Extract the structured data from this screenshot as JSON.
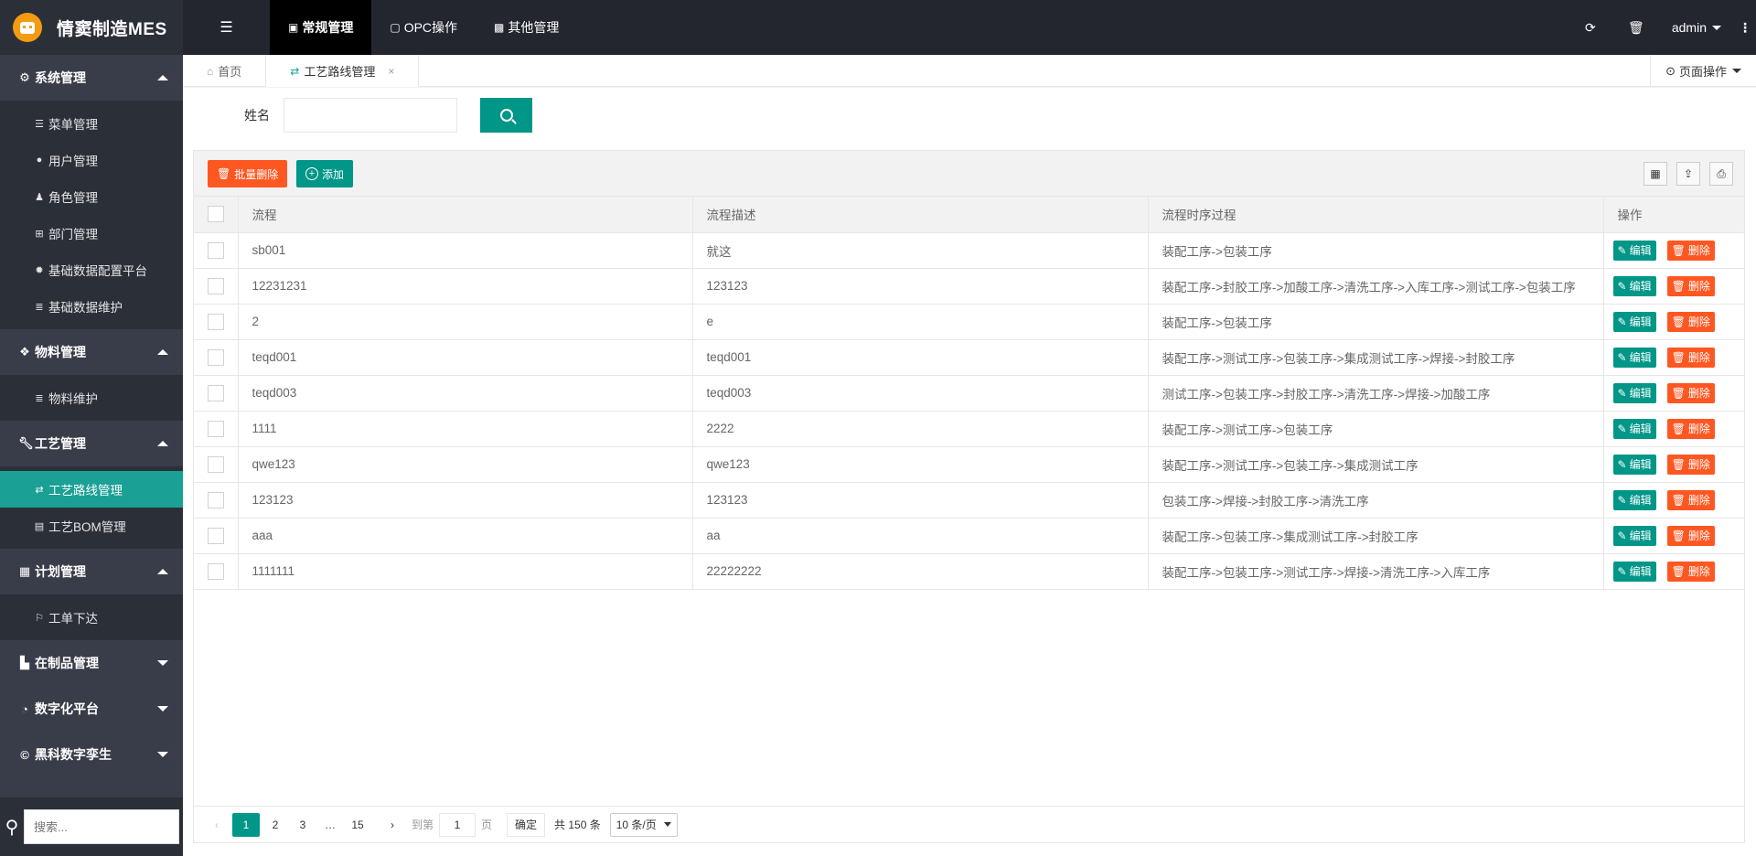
{
  "app": {
    "title": "情窦制造MES"
  },
  "sidebar": {
    "groups": [
      {
        "label": "系统管理",
        "icon": "gears-icon",
        "expanded": true,
        "items": [
          {
            "label": "菜单管理",
            "icon": "list-icon"
          },
          {
            "label": "用户管理",
            "icon": "user-icon"
          },
          {
            "label": "角色管理",
            "icon": "role-icon"
          },
          {
            "label": "部门管理",
            "icon": "sitemap-icon"
          },
          {
            "label": "基础数据配置平台",
            "icon": "gear-icon"
          },
          {
            "label": "基础数据维护",
            "icon": "database-icon"
          }
        ]
      },
      {
        "label": "物料管理",
        "icon": "cubes-icon",
        "expanded": true,
        "items": [
          {
            "label": "物料维护",
            "icon": "database-icon"
          }
        ]
      },
      {
        "label": "工艺管理",
        "icon": "wrench-icon",
        "expanded": true,
        "items": [
          {
            "label": "工艺路线管理",
            "icon": "refresh-icon",
            "active": true
          },
          {
            "label": "工艺BOM管理",
            "icon": "file-icon"
          }
        ]
      },
      {
        "label": "计划管理",
        "icon": "calendar-icon",
        "expanded": true,
        "items": [
          {
            "label": "工单下达",
            "icon": "flag-icon"
          }
        ]
      },
      {
        "label": "在制品管理",
        "icon": "industry-icon",
        "expanded": false,
        "items": []
      },
      {
        "label": "数字化平台",
        "icon": "pie-chart-icon",
        "expanded": false,
        "items": []
      },
      {
        "label": "黑科数字孪生",
        "icon": "copyright-icon",
        "expanded": false,
        "items": []
      }
    ],
    "search_placeholder": "搜索..."
  },
  "topbar": {
    "tabs": [
      {
        "label": "常规管理",
        "icon": "address-book-icon",
        "active": true
      },
      {
        "label": "OPC操作",
        "icon": "comment-icon",
        "active": false
      },
      {
        "label": "其他管理",
        "icon": "slideshare-icon",
        "active": false
      }
    ],
    "user": "admin"
  },
  "tabstrip": {
    "tabs": [
      {
        "label": "首页",
        "icon": "home-icon"
      },
      {
        "label": "工艺路线管理",
        "icon": "refresh-icon",
        "active": true
      }
    ],
    "page_ops": "页面操作"
  },
  "search": {
    "label": "姓名",
    "value": ""
  },
  "toolbar": {
    "batch_delete": "批量删除",
    "add": "添加"
  },
  "table": {
    "columns": [
      "流程",
      "流程描述",
      "流程时序过程",
      "操作"
    ],
    "rows": [
      [
        "sb001",
        "就这",
        "装配工序->包装工序"
      ],
      [
        "12231231",
        "123123",
        "装配工序->封胶工序->加酸工序->清洗工序->入库工序->测试工序->包装工序"
      ],
      [
        "2",
        "e",
        "装配工序->包装工序"
      ],
      [
        "teqd001",
        "teqd001",
        "装配工序->测试工序->包装工序->集成测试工序->焊接->封胶工序"
      ],
      [
        "teqd003",
        "teqd003",
        "测试工序->包装工序->封胶工序->清洗工序->焊接->加酸工序"
      ],
      [
        "1111",
        "2222",
        "装配工序->测试工序->包装工序"
      ],
      [
        "qwe123",
        "qwe123",
        "装配工序->测试工序->包装工序->集成测试工序"
      ],
      [
        "123123",
        "123123",
        "包装工序->焊接->封胶工序->清洗工序"
      ],
      [
        "aaa",
        "aa",
        "装配工序->包装工序->集成测试工序->封胶工序"
      ],
      [
        "1111111",
        "22222222",
        "装配工序->包装工序->测试工序->焊接->清洗工序->入库工序"
      ]
    ],
    "edit_label": "编辑",
    "delete_label": "删除"
  },
  "pager": {
    "pages": [
      "1",
      "2",
      "3"
    ],
    "ellipsis": "…",
    "last": "15",
    "goto_prefix": "到第",
    "goto_value": "1",
    "goto_suffix": "页",
    "confirm": "确定",
    "total": "共 150 条",
    "page_size": "10 条/页"
  }
}
